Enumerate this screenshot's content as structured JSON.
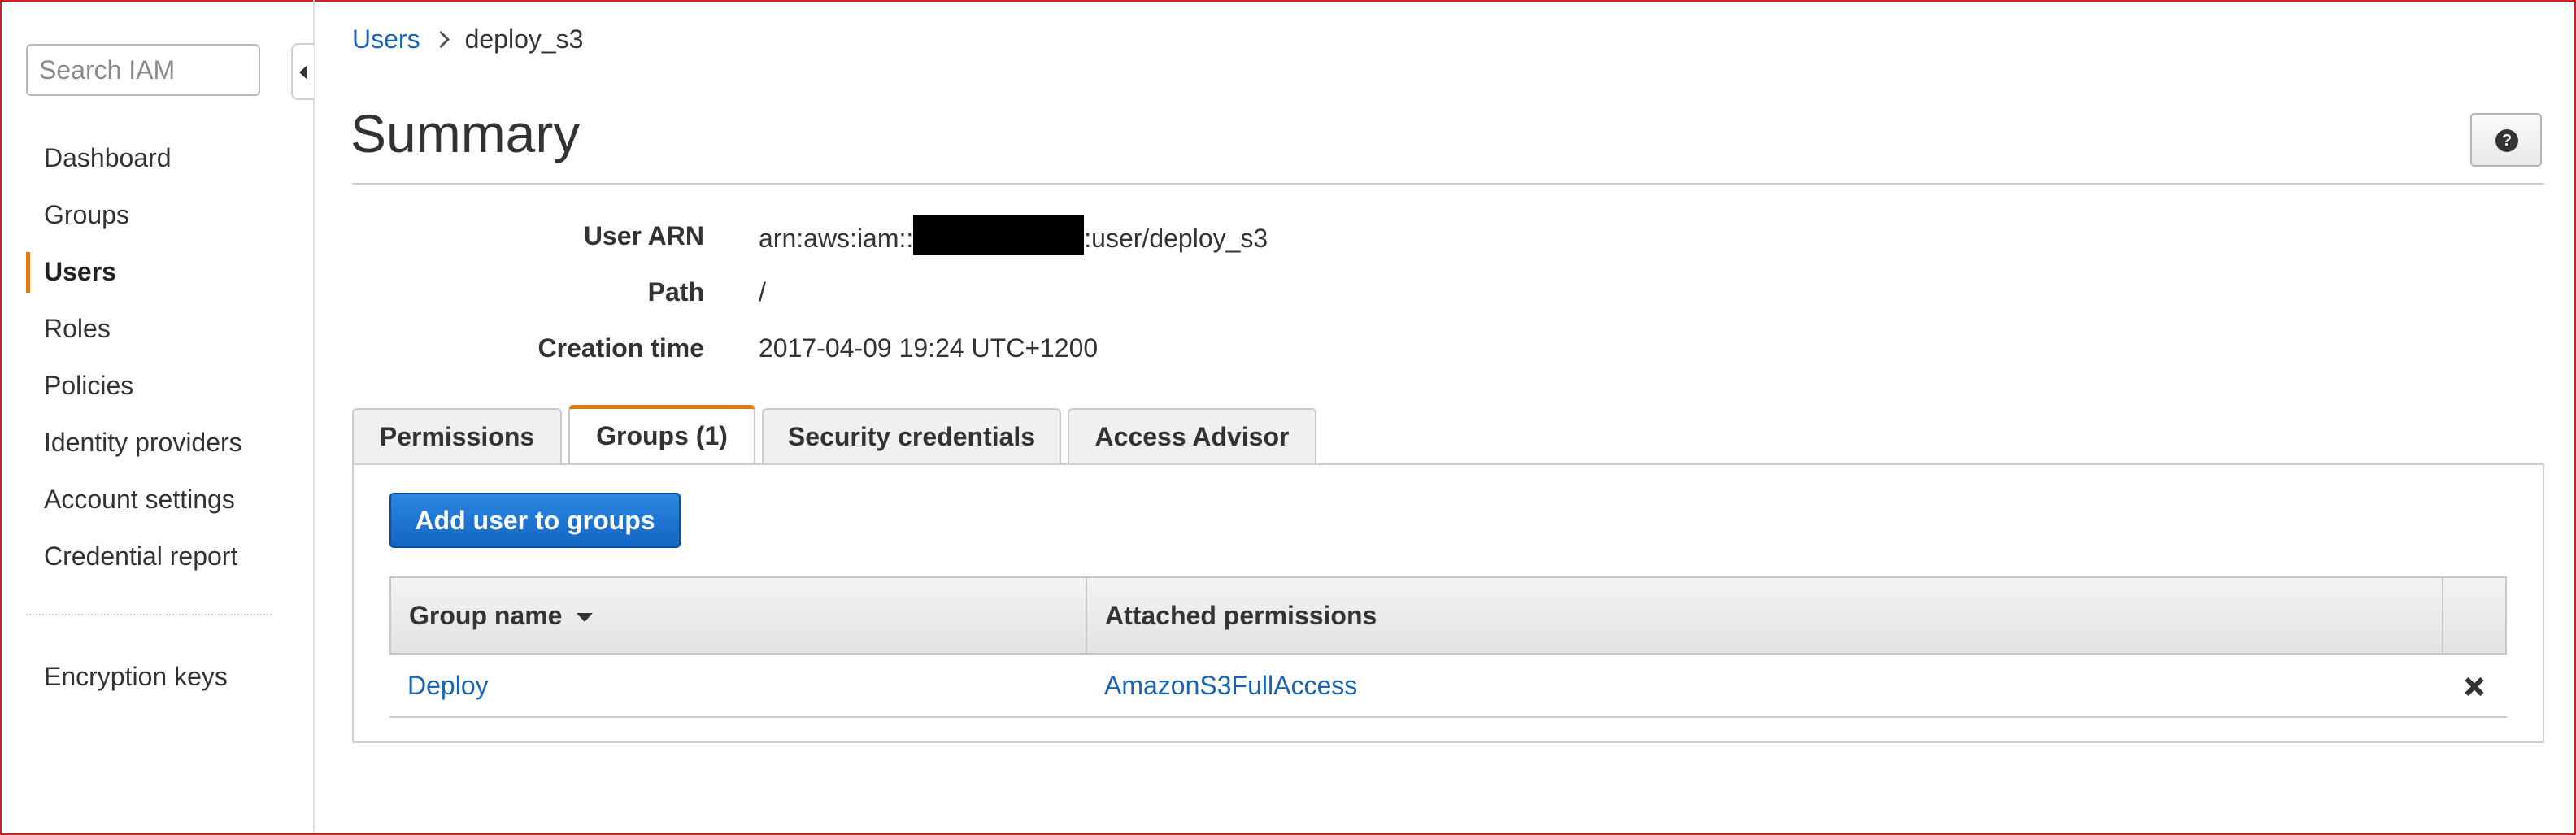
{
  "sidebar": {
    "search_placeholder": "Search IAM",
    "items": [
      {
        "label": "Dashboard"
      },
      {
        "label": "Groups"
      },
      {
        "label": "Users",
        "active": true
      },
      {
        "label": "Roles"
      },
      {
        "label": "Policies"
      },
      {
        "label": "Identity providers"
      },
      {
        "label": "Account settings"
      },
      {
        "label": "Credential report"
      }
    ],
    "secondary_items": [
      {
        "label": "Encryption keys"
      }
    ]
  },
  "breadcrumb": {
    "parent": "Users",
    "current": "deploy_s3"
  },
  "page": {
    "title": "Summary",
    "help_icon": "question-circle-icon"
  },
  "summary": {
    "arn_label": "User ARN",
    "arn_prefix": "arn:aws:iam::",
    "arn_suffix": ":user/deploy_s3",
    "path_label": "Path",
    "path_value": "/",
    "creation_label": "Creation time",
    "creation_value": "2017-04-09 19:24 UTC+1200"
  },
  "tabs": [
    {
      "label": "Permissions"
    },
    {
      "label": "Groups (1)",
      "active": true
    },
    {
      "label": "Security credentials"
    },
    {
      "label": "Access Advisor"
    }
  ],
  "groups_tab": {
    "add_button": "Add user to groups",
    "columns": [
      "Group name",
      "Attached permissions"
    ],
    "rows": [
      {
        "group": "Deploy",
        "permissions": "AmazonS3FullAccess"
      }
    ]
  },
  "colors": {
    "accent": "#e47911",
    "link": "#1a64b6",
    "primary_button": "#1a73d1"
  }
}
